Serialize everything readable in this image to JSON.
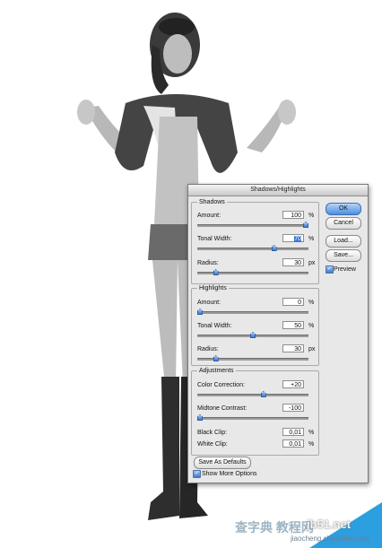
{
  "dialog": {
    "title": "Shadows/Highlights",
    "shadows": {
      "title": "Shadows",
      "amount": {
        "label": "Amount:",
        "value": "100",
        "unit": "%",
        "level": 1.0
      },
      "tonal_width": {
        "label": "Tonal Width:",
        "value": "70",
        "unit": "%",
        "level": 0.7
      },
      "radius": {
        "label": "Radius:",
        "value": "30",
        "unit": "px",
        "level": 0.15
      }
    },
    "highlights": {
      "title": "Highlights",
      "amount": {
        "label": "Amount:",
        "value": "0",
        "unit": "%",
        "level": 0.0
      },
      "tonal_width": {
        "label": "Tonal Width:",
        "value": "50",
        "unit": "%",
        "level": 0.5
      },
      "radius": {
        "label": "Radius:",
        "value": "30",
        "unit": "px",
        "level": 0.15
      }
    },
    "adjustments": {
      "title": "Adjustments",
      "color_correction": {
        "label": "Color Correction:",
        "value": "+20",
        "level": 0.6
      },
      "midtone_contrast": {
        "label": "Midtone Contrast:",
        "value": "-100",
        "level": 0.0
      },
      "black_clip": {
        "label": "Black Clip:",
        "value": "0,01",
        "unit": "%"
      },
      "white_clip": {
        "label": "White Clip:",
        "value": "0,01",
        "unit": "%"
      }
    },
    "buttons": {
      "ok": "OK",
      "cancel": "Cancel",
      "load": "Load...",
      "save": "Save...",
      "save_defaults": "Save As Defaults"
    },
    "checkboxes": {
      "preview": {
        "label": "Preview",
        "checked": true
      },
      "more_options": {
        "label": "Show More Options",
        "checked": true
      }
    }
  },
  "watermark": {
    "site": "jb51.net",
    "brand": "查字典 教程网",
    "url": "jiaocheng.chazidian.com"
  },
  "colors": {
    "accent": "#3f7ad0",
    "dialog_bg": "#e8e8e8"
  }
}
